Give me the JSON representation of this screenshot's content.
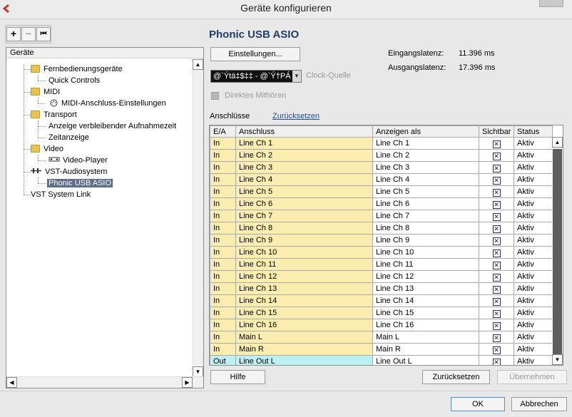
{
  "window": {
    "title": "Geräte konfigurieren"
  },
  "toolbar": {
    "add_label": "+",
    "remove_label": "−",
    "reset_label": "⏮"
  },
  "tree": {
    "header": "Geräte",
    "items": [
      {
        "label": "Fernbedienungsgeräte"
      },
      {
        "label": "Quick Controls"
      },
      {
        "label": "MIDI"
      },
      {
        "label": "MIDI-Anschluss-Einstellungen"
      },
      {
        "label": "Transport"
      },
      {
        "label": "Anzeige verbleibender Aufnahmezeit"
      },
      {
        "label": "Zeitanzeige"
      },
      {
        "label": "Video"
      },
      {
        "label": "Video-Player"
      },
      {
        "label": "VST-Audiosystem"
      },
      {
        "label": "Phonic USB ASIO"
      },
      {
        "label": "VST System Link"
      }
    ]
  },
  "device": {
    "title": "Phonic USB ASIO",
    "settings_button": "Einstellungen...",
    "input_latency_label": "Eingangslatenz:",
    "input_latency_value": "11.396 ms",
    "output_latency_label": "Ausgangslatenz:",
    "output_latency_value": "17.396 ms",
    "clock_value": "@`Ýtä‡$‡‡ - @`Ý†PÁ",
    "clock_label": "Clock-Quelle",
    "direct_monitoring_label": "Direktes Mithören",
    "ports_label": "Anschlüsse",
    "reset_link": "Zurücksetzen"
  },
  "table": {
    "headers": [
      "E/A",
      "Anschluss",
      "Anzeigen als",
      "Sichtbar",
      "Status"
    ],
    "rows": [
      {
        "ea": "In",
        "port": "Line Ch 1",
        "display": "Line Ch 1",
        "visible": "✕",
        "status": "Aktiv"
      },
      {
        "ea": "In",
        "port": "Line Ch 2",
        "display": "Line Ch 2",
        "visible": "✕",
        "status": "Aktiv"
      },
      {
        "ea": "In",
        "port": "Line Ch 3",
        "display": "Line Ch 3",
        "visible": "✕",
        "status": "Aktiv"
      },
      {
        "ea": "In",
        "port": "Line Ch 4",
        "display": "Line Ch 4",
        "visible": "✕",
        "status": "Aktiv"
      },
      {
        "ea": "In",
        "port": "Line Ch 5",
        "display": "Line Ch 5",
        "visible": "✕",
        "status": "Aktiv"
      },
      {
        "ea": "In",
        "port": "Line Ch 6",
        "display": "Line Ch 6",
        "visible": "✕",
        "status": "Aktiv"
      },
      {
        "ea": "In",
        "port": "Line Ch 7",
        "display": "Line Ch 7",
        "visible": "✕",
        "status": "Aktiv"
      },
      {
        "ea": "In",
        "port": "Line Ch 8",
        "display": "Line Ch 8",
        "visible": "✕",
        "status": "Aktiv"
      },
      {
        "ea": "In",
        "port": "Line Ch 9",
        "display": "Line Ch 9",
        "visible": "✕",
        "status": "Aktiv"
      },
      {
        "ea": "In",
        "port": "Line Ch 10",
        "display": "Line Ch 10",
        "visible": "✕",
        "status": "Aktiv"
      },
      {
        "ea": "In",
        "port": "Line Ch 11",
        "display": "Line Ch 11",
        "visible": "✕",
        "status": "Aktiv"
      },
      {
        "ea": "In",
        "port": "Line Ch 12",
        "display": "Line Ch 12",
        "visible": "✕",
        "status": "Aktiv"
      },
      {
        "ea": "In",
        "port": "Line Ch 13",
        "display": "Line Ch 13",
        "visible": "✕",
        "status": "Aktiv"
      },
      {
        "ea": "In",
        "port": "Line Ch 14",
        "display": "Line Ch 14",
        "visible": "✕",
        "status": "Aktiv"
      },
      {
        "ea": "In",
        "port": "Line Ch 15",
        "display": "Line Ch 15",
        "visible": "✕",
        "status": "Aktiv"
      },
      {
        "ea": "In",
        "port": "Line Ch 16",
        "display": "Line Ch 16",
        "visible": "✕",
        "status": "Aktiv"
      },
      {
        "ea": "In",
        "port": "Main L",
        "display": "Main L",
        "visible": "✕",
        "status": "Aktiv"
      },
      {
        "ea": "In",
        "port": "Main R",
        "display": "Main R",
        "visible": "✕",
        "status": "Aktiv"
      },
      {
        "ea": "Out",
        "port": "Line Out L",
        "display": "Line Out L",
        "visible": "✕",
        "status": "Aktiv"
      }
    ]
  },
  "buttons": {
    "help": "Hilfe",
    "reset": "Zurücksetzen",
    "apply": "Übernehmen",
    "ok": "OK",
    "cancel": "Abbrechen"
  },
  "colors": {
    "input_row": "#fbecb0",
    "output_row": "#bdf0f4",
    "selection": "#5c6e8c",
    "title_blue": "#1e3f66"
  }
}
